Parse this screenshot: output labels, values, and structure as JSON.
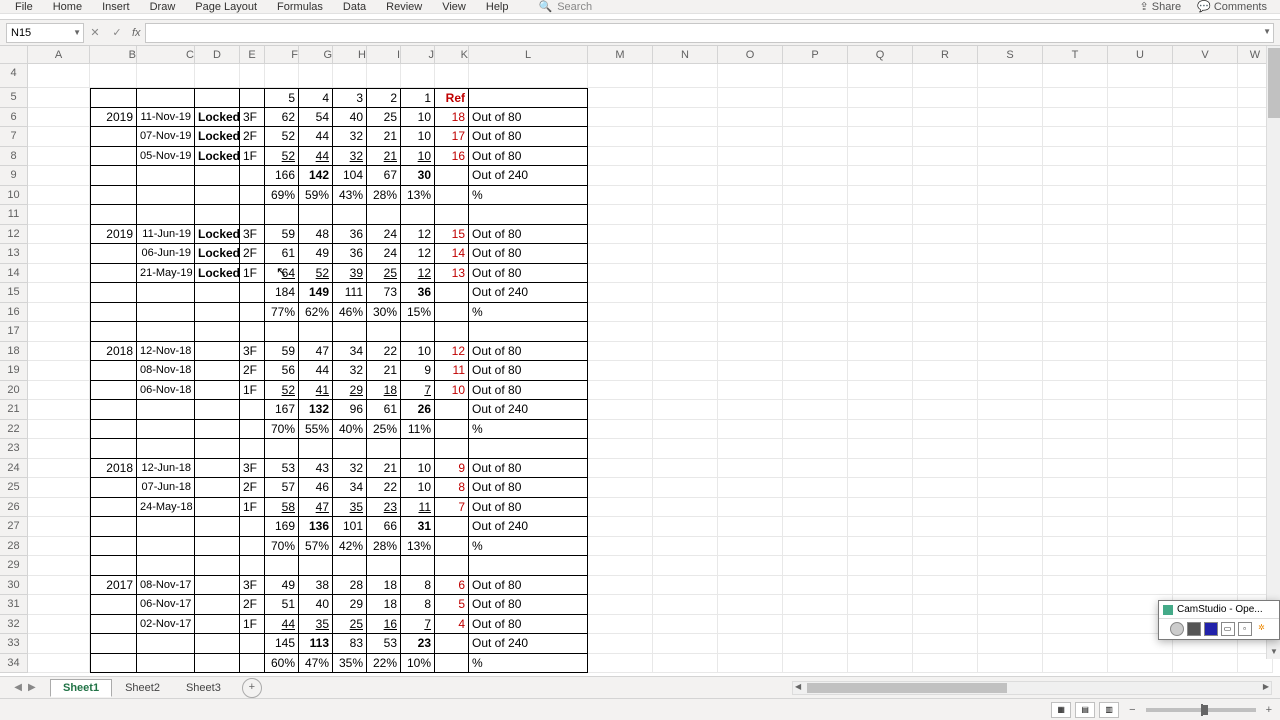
{
  "ribbon": {
    "tabs": [
      "File",
      "Home",
      "Insert",
      "Draw",
      "Page Layout",
      "Formulas",
      "Data",
      "Review",
      "View",
      "Help"
    ],
    "search_placeholder": "Search",
    "share": "Share",
    "comments": "Comments"
  },
  "namebox": "N15",
  "formula": "",
  "columns": [
    "A",
    "B",
    "C",
    "D",
    "E",
    "F",
    "G",
    "H",
    "I",
    "J",
    "K",
    "L",
    "M",
    "N",
    "O",
    "P",
    "Q",
    "R",
    "S",
    "T",
    "U",
    "V",
    "W"
  ],
  "row_start": 4,
  "row_end": 34,
  "header_row": {
    "F": "5",
    "G": "4",
    "H": "3",
    "I": "2",
    "J": "1",
    "K": "Ref"
  },
  "blocks": [
    {
      "year": "2019",
      "rows": [
        {
          "r": 6,
          "date": "11-Nov-19",
          "status": "Locked",
          "flr": "3F",
          "v": [
            "62",
            "54",
            "40",
            "25",
            "10"
          ],
          "ref": "18",
          "note": "Out of 80"
        },
        {
          "r": 7,
          "date": "07-Nov-19",
          "status": "Locked",
          "flr": "2F",
          "v": [
            "52",
            "44",
            "32",
            "21",
            "10"
          ],
          "ref": "17",
          "note": "Out of 80"
        },
        {
          "r": 8,
          "date": "05-Nov-19",
          "status": "Locked",
          "flr": "1F",
          "v": [
            "52",
            "44",
            "32",
            "21",
            "10"
          ],
          "ref": "16",
          "note": "Out of 80",
          "ul": true
        }
      ],
      "totals": {
        "r": 9,
        "v": [
          "166",
          "142",
          "104",
          "67",
          "30"
        ],
        "note": "Out of 240"
      },
      "pct": {
        "r": 10,
        "v": [
          "69%",
          "59%",
          "43%",
          "28%",
          "13%"
        ],
        "note": "%"
      }
    },
    {
      "year": "2019",
      "rows": [
        {
          "r": 12,
          "date": "11-Jun-19",
          "status": "Locked",
          "flr": "3F",
          "v": [
            "59",
            "48",
            "36",
            "24",
            "12"
          ],
          "ref": "15",
          "note": "Out of 80"
        },
        {
          "r": 13,
          "date": "06-Jun-19",
          "status": "Locked",
          "flr": "2F",
          "v": [
            "61",
            "49",
            "36",
            "24",
            "12"
          ],
          "ref": "14",
          "note": "Out of 80"
        },
        {
          "r": 14,
          "date": "21-May-19",
          "status": "Locked",
          "flr": "1F",
          "v": [
            "64",
            "52",
            "39",
            "25",
            "12"
          ],
          "ref": "13",
          "note": "Out of 80",
          "ul": true
        }
      ],
      "totals": {
        "r": 15,
        "v": [
          "184",
          "149",
          "111",
          "73",
          "36"
        ],
        "note": "Out of 240"
      },
      "pct": {
        "r": 16,
        "v": [
          "77%",
          "62%",
          "46%",
          "30%",
          "15%"
        ],
        "note": "%"
      }
    },
    {
      "year": "2018",
      "rows": [
        {
          "r": 18,
          "date": "12-Nov-18",
          "status": "",
          "flr": "3F",
          "v": [
            "59",
            "47",
            "34",
            "22",
            "10"
          ],
          "ref": "12",
          "note": "Out of 80"
        },
        {
          "r": 19,
          "date": "08-Nov-18",
          "status": "",
          "flr": "2F",
          "v": [
            "56",
            "44",
            "32",
            "21",
            "9"
          ],
          "ref": "11",
          "note": "Out of 80"
        },
        {
          "r": 20,
          "date": "06-Nov-18",
          "status": "",
          "flr": "1F",
          "v": [
            "52",
            "41",
            "29",
            "18",
            "7"
          ],
          "ref": "10",
          "note": "Out of 80",
          "ul": true
        }
      ],
      "totals": {
        "r": 21,
        "v": [
          "167",
          "132",
          "96",
          "61",
          "26"
        ],
        "note": "Out of 240"
      },
      "pct": {
        "r": 22,
        "v": [
          "70%",
          "55%",
          "40%",
          "25%",
          "11%"
        ],
        "note": "%"
      }
    },
    {
      "year": "2018",
      "rows": [
        {
          "r": 24,
          "date": "12-Jun-18",
          "status": "",
          "flr": "3F",
          "v": [
            "53",
            "43",
            "32",
            "21",
            "10"
          ],
          "ref": "9",
          "note": "Out of 80"
        },
        {
          "r": 25,
          "date": "07-Jun-18",
          "status": "",
          "flr": "2F",
          "v": [
            "57",
            "46",
            "34",
            "22",
            "10"
          ],
          "ref": "8",
          "note": "Out of 80"
        },
        {
          "r": 26,
          "date": "24-May-18",
          "status": "",
          "flr": "1F",
          "v": [
            "58",
            "47",
            "35",
            "23",
            "11"
          ],
          "ref": "7",
          "note": "Out of 80",
          "ul": true
        }
      ],
      "totals": {
        "r": 27,
        "v": [
          "169",
          "136",
          "101",
          "66",
          "31"
        ],
        "note": "Out of 240"
      },
      "pct": {
        "r": 28,
        "v": [
          "70%",
          "57%",
          "42%",
          "28%",
          "13%"
        ],
        "note": "%"
      }
    },
    {
      "year": "2017",
      "rows": [
        {
          "r": 30,
          "date": "08-Nov-17",
          "status": "",
          "flr": "3F",
          "v": [
            "49",
            "38",
            "28",
            "18",
            "8"
          ],
          "ref": "6",
          "note": "Out of 80"
        },
        {
          "r": 31,
          "date": "06-Nov-17",
          "status": "",
          "flr": "2F",
          "v": [
            "51",
            "40",
            "29",
            "18",
            "8"
          ],
          "ref": "5",
          "note": "Out of 80"
        },
        {
          "r": 32,
          "date": "02-Nov-17",
          "status": "",
          "flr": "1F",
          "v": [
            "44",
            "35",
            "25",
            "16",
            "7"
          ],
          "ref": "4",
          "note": "Out of 80",
          "ul": true
        }
      ],
      "totals": {
        "r": 33,
        "v": [
          "145",
          "113",
          "83",
          "53",
          "23"
        ],
        "note": "Out of 240"
      },
      "pct": {
        "r": 34,
        "v": [
          "60%",
          "47%",
          "35%",
          "22%",
          "10%"
        ],
        "note": "%"
      }
    }
  ],
  "sheets": [
    "Sheet1",
    "Sheet2",
    "Sheet3"
  ],
  "active_sheet": 0,
  "zoom": "100%",
  "camstudio_title": "CamStudio - Ope..."
}
